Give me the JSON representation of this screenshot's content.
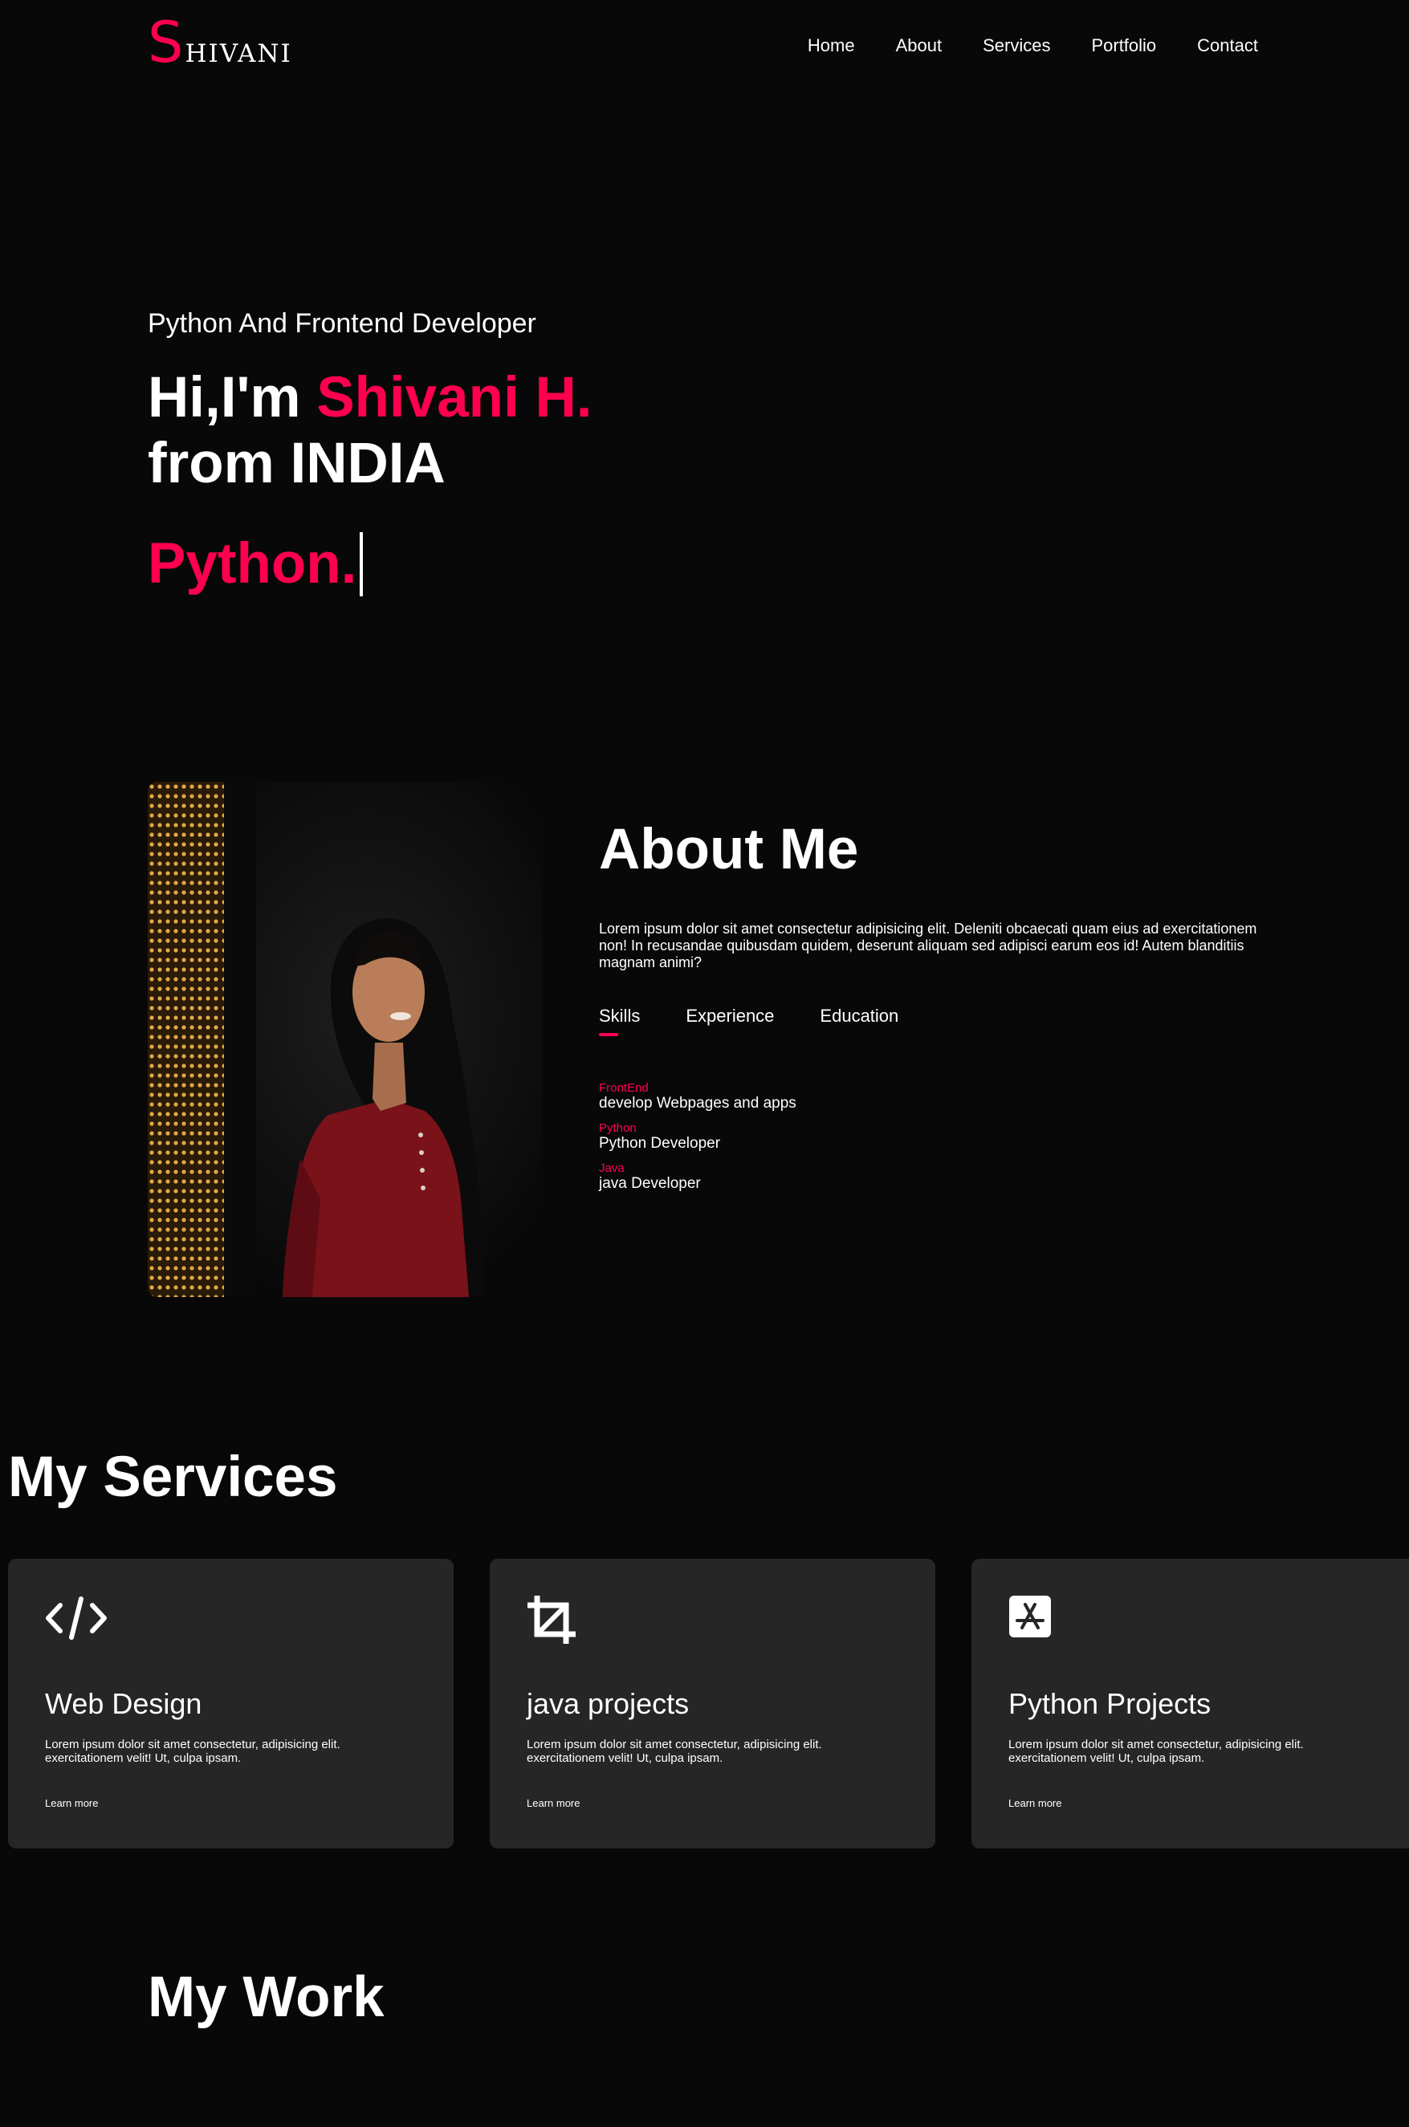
{
  "brand": {
    "initial": "S",
    "rest": "HIVANI"
  },
  "nav": {
    "items": [
      {
        "label": "Home"
      },
      {
        "label": "About"
      },
      {
        "label": "Services"
      },
      {
        "label": "Portfolio"
      },
      {
        "label": "Contact"
      }
    ]
  },
  "hero": {
    "role": "Python And Frontend Developer",
    "greeting": "Hi,I'm ",
    "name": "Shivani H.",
    "origin": "from INDIA",
    "typed": "Python."
  },
  "about": {
    "heading": "About Me",
    "text": "Lorem ipsum dolor sit amet consectetur adipisicing elit. Deleniti obcaecati quam eius ad exercitationem non! In recusandae quibusdam quidem, deserunt aliquam sed adipisci earum eos id! Autem blanditiis magnam animi?",
    "tabs": [
      {
        "label": "Skills",
        "active": true
      },
      {
        "label": "Experience",
        "active": false
      },
      {
        "label": "Education",
        "active": false
      }
    ],
    "skills": [
      {
        "title": "FrontEnd",
        "desc": "develop Webpages and apps"
      },
      {
        "title": "Python",
        "desc": "Python Developer"
      },
      {
        "title": "Java",
        "desc": "java Developer"
      }
    ]
  },
  "services": {
    "heading": "My Services",
    "cards": [
      {
        "icon": "code-icon",
        "title": "Web Design",
        "text": "Lorem ipsum dolor sit amet consectetur, adipisicing elit. exercitationem velit! Ut, culpa ipsam.",
        "link": "Learn more"
      },
      {
        "icon": "crop-icon",
        "title": "java projects",
        "text": "Lorem ipsum dolor sit amet consectetur, adipisicing elit. exercitationem velit! Ut, culpa ipsam.",
        "link": "Learn more"
      },
      {
        "icon": "app-store-icon",
        "title": "Python Projects",
        "text": "Lorem ipsum dolor sit amet consectetur, adipisicing elit. exercitationem velit! Ut, culpa ipsam.",
        "link": "Learn more"
      }
    ]
  },
  "work": {
    "heading": "My Work"
  },
  "colors": {
    "accent": "#ff004f",
    "background": "#080808",
    "card": "#262626"
  }
}
